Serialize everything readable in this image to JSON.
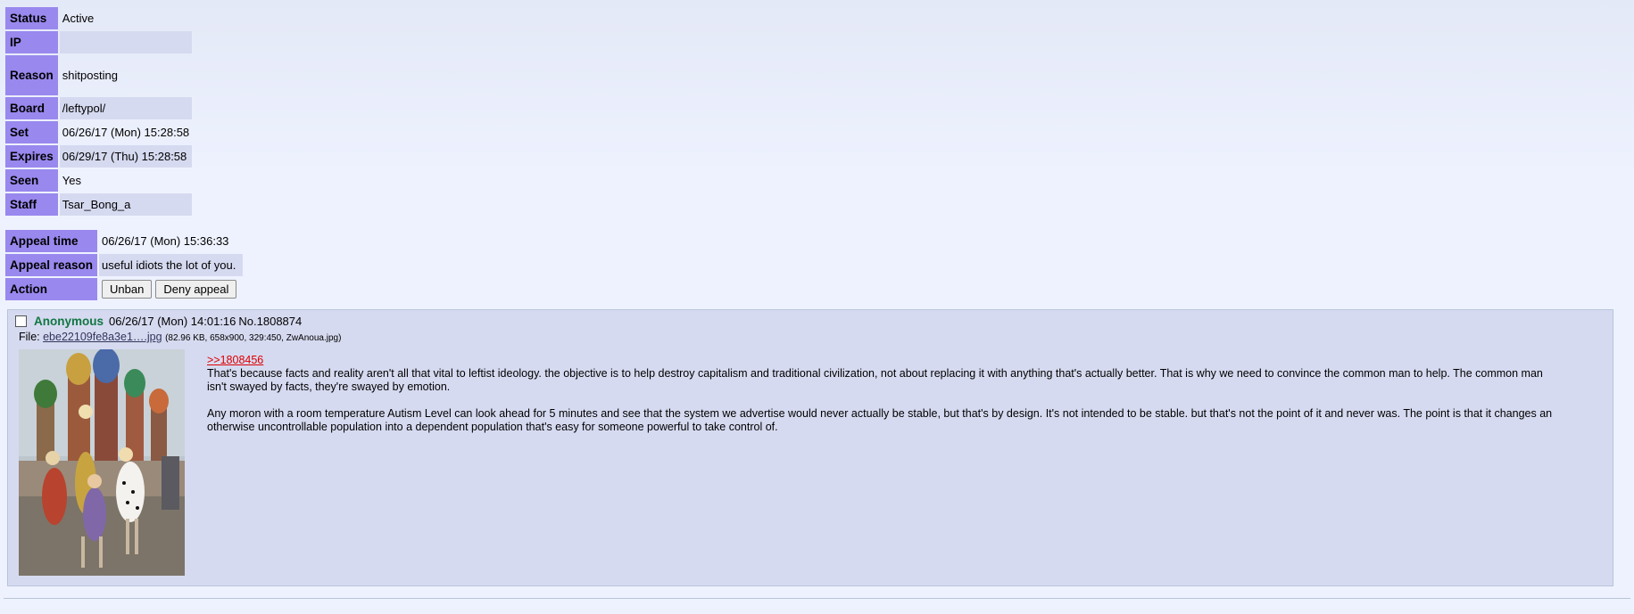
{
  "ban": {
    "rows": [
      {
        "label": "Status",
        "value": "Active"
      },
      {
        "label": "IP",
        "value": ""
      },
      {
        "label": "Reason",
        "value": "shitposting"
      },
      {
        "label": "Board",
        "value": "/leftypol/"
      },
      {
        "label": "Set",
        "value": "06/26/17 (Mon) 15:28:58"
      },
      {
        "label": "Expires",
        "value": "06/29/17 (Thu) 15:28:58"
      },
      {
        "label": "Seen",
        "value": "Yes"
      },
      {
        "label": "Staff",
        "value": "Tsar_Bong_a"
      }
    ]
  },
  "appeal": {
    "time_label": "Appeal time",
    "time_value": "06/26/17 (Mon) 15:36:33",
    "reason_label": "Appeal reason",
    "reason_value": "useful idiots the lot of you.",
    "action_label": "Action",
    "unban_label": "Unban",
    "deny_label": "Deny appeal"
  },
  "post": {
    "name": "Anonymous",
    "datetime": "06/26/17 (Mon) 14:01:16",
    "number": "No.1808874",
    "file_label": "File:",
    "file_name": "ebe22109fe8a3e1….jpg",
    "file_meta": "(82.96 KB, 658x900, 329:450, ZwAnoua.jpg)",
    "quote_link": ">>1808456",
    "paragraphs": [
      "That's because facts and reality aren't all that vital to leftist ideology. the objective is to help destroy capitalism and traditional civilization, not about replacing it with anything that's actually better. That is why we need to convince the common man to help. The common man isn't swayed by facts, they're swayed by emotion.",
      "Any moron with a room temperature Autism Level can look ahead for 5 minutes and see that the system we advertise would never actually be stable, but that's by design. It's not intended to be stable. but that's not the point of it and never was. The point is that it changes an otherwise uncontrollable population into a dependent population that's easy for someone powerful to take control of."
    ]
  }
}
